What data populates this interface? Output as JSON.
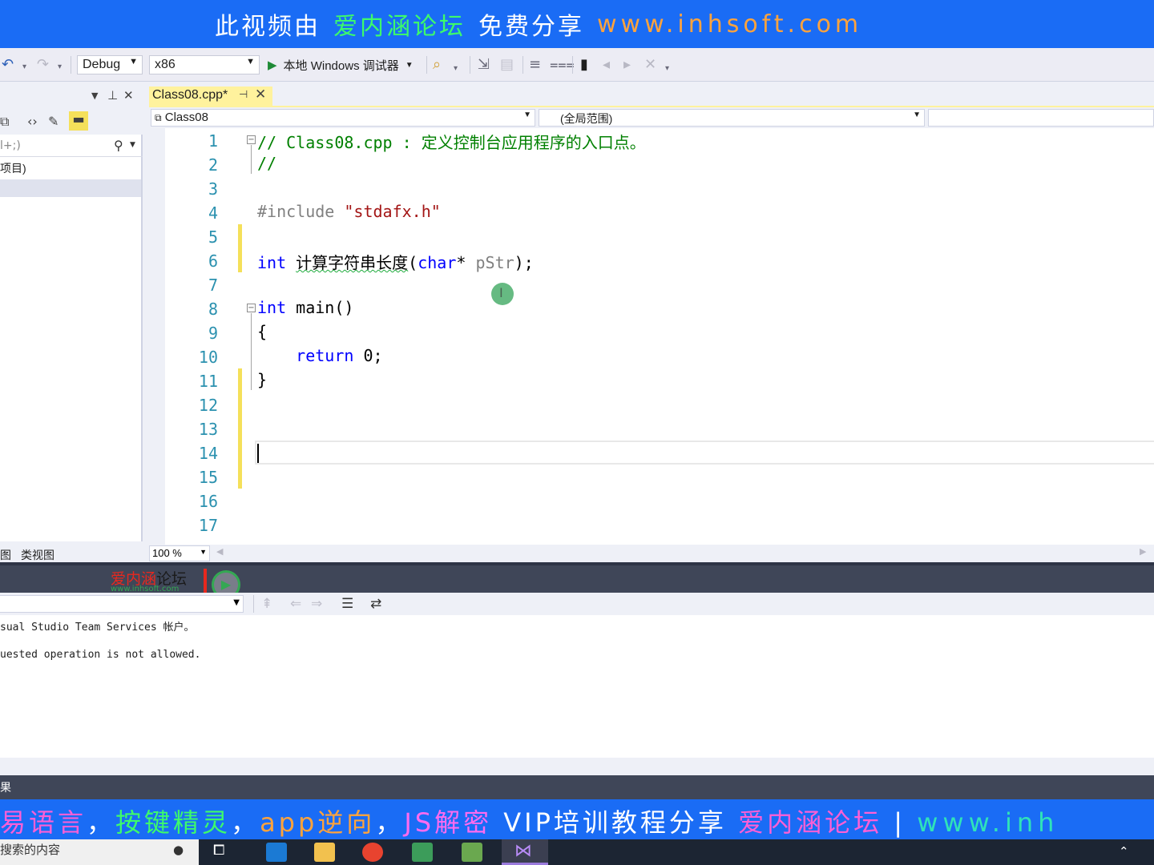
{
  "top_banner": {
    "part1": "此视频由",
    "part2": "爱内涵论坛",
    "part3": "免费分享",
    "part4": "www.inhsoft.com"
  },
  "toolbar": {
    "config": "Debug",
    "platform": "x86",
    "run_label": "本地 Windows 调试器"
  },
  "left_panel": {
    "search_placeholder": "l+;)",
    "item": "项目)",
    "tab1": "图",
    "tab2": "类视图"
  },
  "editor": {
    "tab_title": "Class08.cpp*",
    "nav_scope": "Class08",
    "nav_member": "(全局范围)",
    "zoom": "100 %",
    "line_numbers": [
      "1",
      "2",
      "3",
      "4",
      "5",
      "6",
      "7",
      "8",
      "9",
      "10",
      "11",
      "12",
      "13",
      "14",
      "15",
      "16",
      "17"
    ],
    "line1": "// Class08.cpp : 定义控制台应用程序的入口点。",
    "line2": "//",
    "line4_directive": "#include ",
    "line4_file": "\"stdafx.h\"",
    "line6_type": "int",
    "line6_fn": "计算字符串长度",
    "line6_open": "(",
    "line6_ptype": "char",
    "line6_star": "* ",
    "line6_param": "pStr",
    "line6_close": ");",
    "line8_type": "int",
    "line8_rest": " main()",
    "line9": "{",
    "line10_kw": "return",
    "line10_rest": " 0;",
    "line11": "}"
  },
  "watermark_logo": {
    "red": "爱内涵",
    "black": "论坛",
    "url": "www.inhsoft.com"
  },
  "output": {
    "line1": "sual Studio Team Services 帐户。",
    "line2": "uested operation is not allowed.",
    "tab": "果"
  },
  "bottom_banner": {
    "seg1": "易语言",
    "sep1": "，",
    "seg2": "按键精灵",
    "sep2": "，",
    "seg3": "app逆向",
    "sep3": "，",
    "seg4": "JS解密",
    "seg5": "VIP培训教程分享",
    "seg6": "爱内涵论坛",
    "sep4": "|",
    "seg7": "www.inh"
  },
  "taskbar": {
    "search_text": "搜索的内容"
  },
  "colors": {
    "banner_blue": "#1a6cf5",
    "tab_yellow": "#fff29d",
    "change_bar": "#f5e05a",
    "keyword": "#0000ff",
    "comment": "#008000",
    "string": "#a31515",
    "line_number": "#2b91af"
  }
}
